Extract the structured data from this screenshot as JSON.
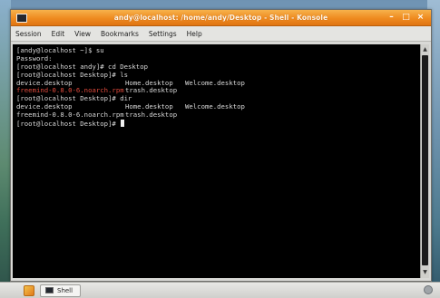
{
  "window": {
    "title": "andy@localhost: /home/andy/Desktop - Shell - Konsole"
  },
  "menubar": {
    "items": [
      "Session",
      "Edit",
      "View",
      "Bookmarks",
      "Settings",
      "Help"
    ]
  },
  "terminal": {
    "lines": [
      {
        "prompt": "[andy@localhost ~]$ ",
        "command": "su"
      },
      {
        "text": "Password:"
      },
      {
        "prompt": "[root@localhost andy]# ",
        "command": "cd Desktop"
      },
      {
        "prompt": "[root@localhost Desktop]# ",
        "command": "ls"
      },
      {
        "cols": [
          "device.desktop",
          "Home.desktop",
          "Welcome.desktop"
        ]
      },
      {
        "cols": [
          "freemind-0.8.0-6.noarch.rpm",
          "trash.desktop"
        ],
        "first_col_color": "red"
      },
      {
        "prompt": "[root@localhost Desktop]# ",
        "command": "dir"
      },
      {
        "cols": [
          "device.desktop",
          "Home.desktop",
          "Welcome.desktop"
        ]
      },
      {
        "cols": [
          "freemind-0.8.0-6.noarch.rpm",
          "trash.desktop"
        ]
      },
      {
        "prompt": "[root@localhost Desktop]# ",
        "command": "",
        "cursor": true
      }
    ]
  },
  "taskbar": {
    "task_label": "Shell"
  },
  "colors": {
    "titlebar": "#ee8a1f",
    "terminal_bg": "#000000",
    "terminal_fg": "#d8d8d8",
    "rpm_red": "#e24a3c"
  }
}
